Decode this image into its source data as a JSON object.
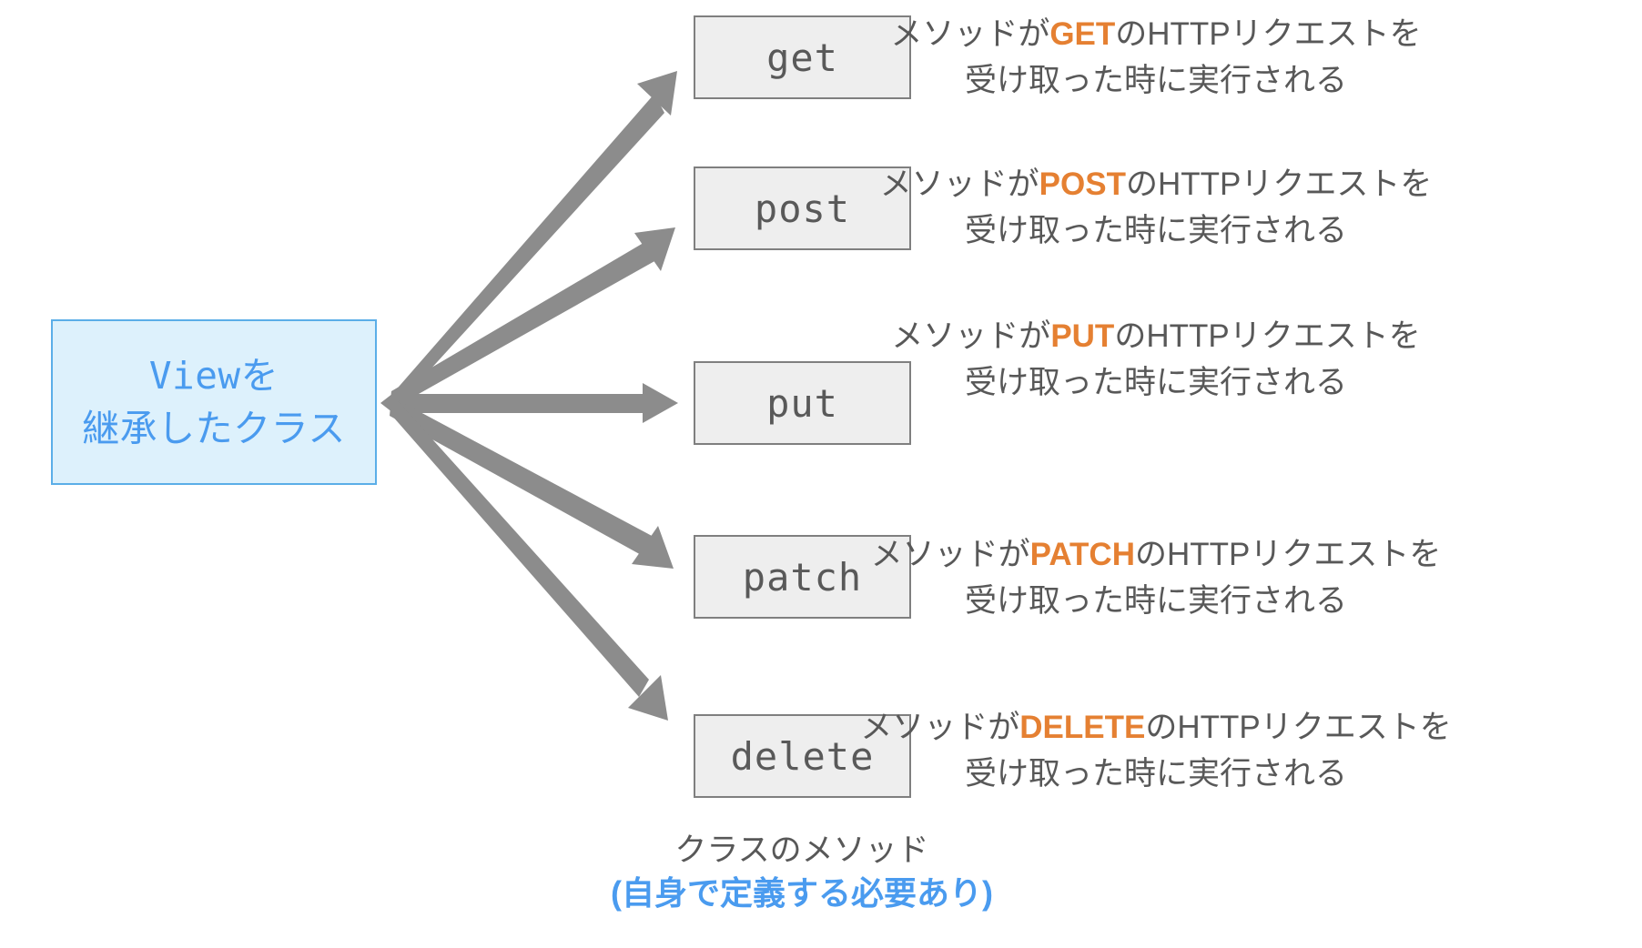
{
  "diagram": {
    "source": {
      "line1": "Viewを",
      "line2": "継承したクラス",
      "fill_color": "#DDF1FC",
      "border_color": "#5BAEE8",
      "text_color": "#4A9BEF"
    },
    "arrow_color": "#8C8C8C",
    "method_box": {
      "fill_color": "#EEEEEE",
      "border_color": "#7F7F7F",
      "text_color": "#595959"
    },
    "accent_color": "#E58032",
    "rows": [
      {
        "method": "get",
        "verb": "GET",
        "desc_prefix": "メソッドが",
        "desc_suffix": "のHTTPリクエストを",
        "desc_line2": "受け取った時に実行される"
      },
      {
        "method": "post",
        "verb": "POST",
        "desc_prefix": "メソッドが",
        "desc_suffix": "のHTTPリクエストを",
        "desc_line2": "受け取った時に実行される"
      },
      {
        "method": "put",
        "verb": "PUT",
        "desc_prefix": "メソッドが",
        "desc_suffix": "のHTTPリクエストを",
        "desc_line2": "受け取った時に実行される"
      },
      {
        "method": "patch",
        "verb": "PATCH",
        "desc_prefix": "メソッドが",
        "desc_suffix": "のHTTPリクエストを",
        "desc_line2": "受け取った時に実行される"
      },
      {
        "method": "delete",
        "verb": "DELETE",
        "desc_prefix": "メソッドが",
        "desc_suffix": "のHTTPリクエストを",
        "desc_line2": "受け取った時に実行される"
      }
    ],
    "caption": {
      "line1": "クラスのメソッド",
      "line2": "(自身で定義する必要あり)"
    }
  }
}
